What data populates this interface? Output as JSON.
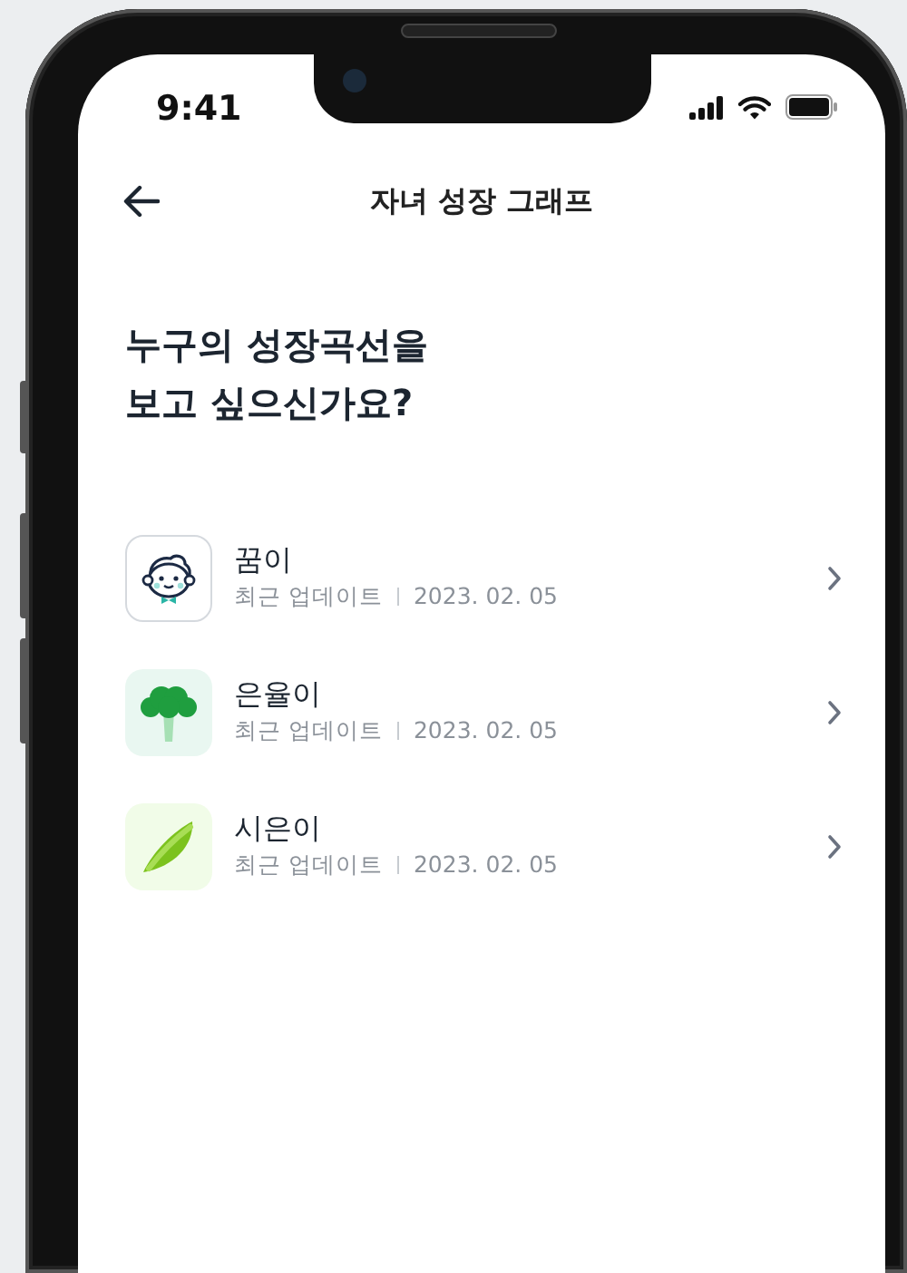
{
  "status_bar": {
    "time": "9:41"
  },
  "header": {
    "title": "자녀 성장 그래프"
  },
  "heading": {
    "lines": [
      "누구의 성장곡선을",
      "보고 싶으신가요?"
    ]
  },
  "children": [
    {
      "name": "꿈이",
      "update_label": "최근 업데이트",
      "date": "2023. 02. 05",
      "kind": "boy"
    },
    {
      "name": "은율이",
      "update_label": "최근 업데이트",
      "date": "2023. 02. 05",
      "kind": "broccoli"
    },
    {
      "name": "시은이",
      "update_label": "최근 업데이트",
      "date": "2023. 02. 05",
      "kind": "peapod"
    }
  ]
}
